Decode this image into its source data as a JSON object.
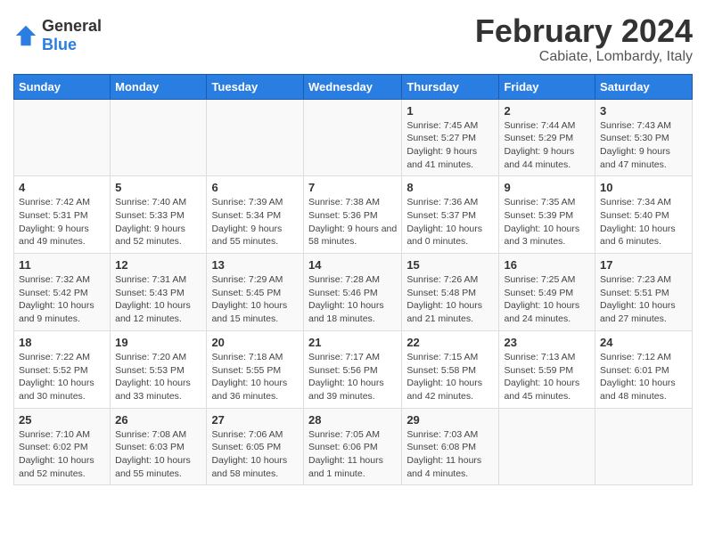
{
  "logo": {
    "line1": "General",
    "line2": "Blue"
  },
  "title": "February 2024",
  "subtitle": "Cabiate, Lombardy, Italy",
  "days_of_week": [
    "Sunday",
    "Monday",
    "Tuesday",
    "Wednesday",
    "Thursday",
    "Friday",
    "Saturday"
  ],
  "weeks": [
    [
      {
        "day": "",
        "info": ""
      },
      {
        "day": "",
        "info": ""
      },
      {
        "day": "",
        "info": ""
      },
      {
        "day": "",
        "info": ""
      },
      {
        "day": "1",
        "info": "Sunrise: 7:45 AM\nSunset: 5:27 PM\nDaylight: 9 hours and 41 minutes."
      },
      {
        "day": "2",
        "info": "Sunrise: 7:44 AM\nSunset: 5:29 PM\nDaylight: 9 hours and 44 minutes."
      },
      {
        "day": "3",
        "info": "Sunrise: 7:43 AM\nSunset: 5:30 PM\nDaylight: 9 hours and 47 minutes."
      }
    ],
    [
      {
        "day": "4",
        "info": "Sunrise: 7:42 AM\nSunset: 5:31 PM\nDaylight: 9 hours and 49 minutes."
      },
      {
        "day": "5",
        "info": "Sunrise: 7:40 AM\nSunset: 5:33 PM\nDaylight: 9 hours and 52 minutes."
      },
      {
        "day": "6",
        "info": "Sunrise: 7:39 AM\nSunset: 5:34 PM\nDaylight: 9 hours and 55 minutes."
      },
      {
        "day": "7",
        "info": "Sunrise: 7:38 AM\nSunset: 5:36 PM\nDaylight: 9 hours and 58 minutes."
      },
      {
        "day": "8",
        "info": "Sunrise: 7:36 AM\nSunset: 5:37 PM\nDaylight: 10 hours and 0 minutes."
      },
      {
        "day": "9",
        "info": "Sunrise: 7:35 AM\nSunset: 5:39 PM\nDaylight: 10 hours and 3 minutes."
      },
      {
        "day": "10",
        "info": "Sunrise: 7:34 AM\nSunset: 5:40 PM\nDaylight: 10 hours and 6 minutes."
      }
    ],
    [
      {
        "day": "11",
        "info": "Sunrise: 7:32 AM\nSunset: 5:42 PM\nDaylight: 10 hours and 9 minutes."
      },
      {
        "day": "12",
        "info": "Sunrise: 7:31 AM\nSunset: 5:43 PM\nDaylight: 10 hours and 12 minutes."
      },
      {
        "day": "13",
        "info": "Sunrise: 7:29 AM\nSunset: 5:45 PM\nDaylight: 10 hours and 15 minutes."
      },
      {
        "day": "14",
        "info": "Sunrise: 7:28 AM\nSunset: 5:46 PM\nDaylight: 10 hours and 18 minutes."
      },
      {
        "day": "15",
        "info": "Sunrise: 7:26 AM\nSunset: 5:48 PM\nDaylight: 10 hours and 21 minutes."
      },
      {
        "day": "16",
        "info": "Sunrise: 7:25 AM\nSunset: 5:49 PM\nDaylight: 10 hours and 24 minutes."
      },
      {
        "day": "17",
        "info": "Sunrise: 7:23 AM\nSunset: 5:51 PM\nDaylight: 10 hours and 27 minutes."
      }
    ],
    [
      {
        "day": "18",
        "info": "Sunrise: 7:22 AM\nSunset: 5:52 PM\nDaylight: 10 hours and 30 minutes."
      },
      {
        "day": "19",
        "info": "Sunrise: 7:20 AM\nSunset: 5:53 PM\nDaylight: 10 hours and 33 minutes."
      },
      {
        "day": "20",
        "info": "Sunrise: 7:18 AM\nSunset: 5:55 PM\nDaylight: 10 hours and 36 minutes."
      },
      {
        "day": "21",
        "info": "Sunrise: 7:17 AM\nSunset: 5:56 PM\nDaylight: 10 hours and 39 minutes."
      },
      {
        "day": "22",
        "info": "Sunrise: 7:15 AM\nSunset: 5:58 PM\nDaylight: 10 hours and 42 minutes."
      },
      {
        "day": "23",
        "info": "Sunrise: 7:13 AM\nSunset: 5:59 PM\nDaylight: 10 hours and 45 minutes."
      },
      {
        "day": "24",
        "info": "Sunrise: 7:12 AM\nSunset: 6:01 PM\nDaylight: 10 hours and 48 minutes."
      }
    ],
    [
      {
        "day": "25",
        "info": "Sunrise: 7:10 AM\nSunset: 6:02 PM\nDaylight: 10 hours and 52 minutes."
      },
      {
        "day": "26",
        "info": "Sunrise: 7:08 AM\nSunset: 6:03 PM\nDaylight: 10 hours and 55 minutes."
      },
      {
        "day": "27",
        "info": "Sunrise: 7:06 AM\nSunset: 6:05 PM\nDaylight: 10 hours and 58 minutes."
      },
      {
        "day": "28",
        "info": "Sunrise: 7:05 AM\nSunset: 6:06 PM\nDaylight: 11 hours and 1 minute."
      },
      {
        "day": "29",
        "info": "Sunrise: 7:03 AM\nSunset: 6:08 PM\nDaylight: 11 hours and 4 minutes."
      },
      {
        "day": "",
        "info": ""
      },
      {
        "day": "",
        "info": ""
      }
    ]
  ]
}
